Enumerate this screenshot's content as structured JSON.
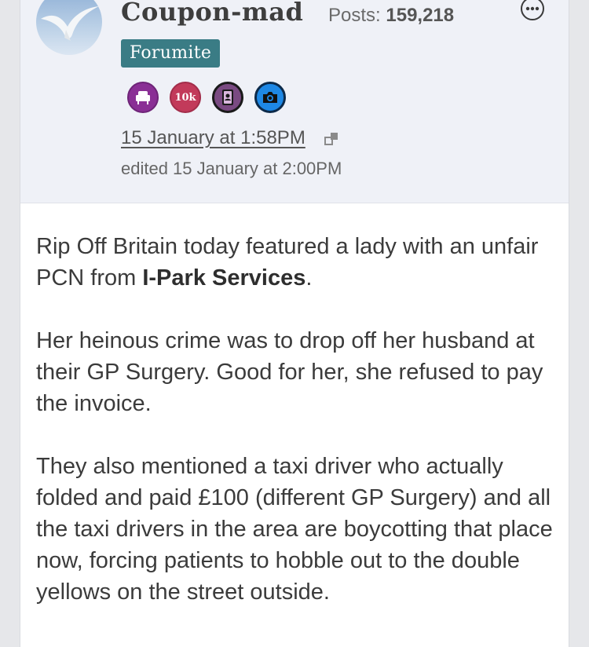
{
  "post": {
    "username": "Coupon-mad",
    "posts_label": "Posts:",
    "posts_count": "159,218",
    "rank": "Forumite",
    "badges": [
      {
        "icon": "armchair-icon",
        "color": "#8a2f95"
      },
      {
        "icon": "10k-badge",
        "label": "10k",
        "color": "#c23a5a"
      },
      {
        "icon": "address-book-icon",
        "color": "#7a4a82"
      },
      {
        "icon": "camera-icon",
        "color": "#1e88e5"
      }
    ],
    "date": "15 January at 1:58PM",
    "edited": "edited 15 January at 2:00PM",
    "body": {
      "p1_pre": "Rip Off Britain today featured a lady with an unfair PCN from ",
      "p1_bold": "I-Park Services",
      "p1_post": ".",
      "p2": "Her heinous crime was to drop off her husband at their GP Surgery. Good for her, she refused to pay the invoice.",
      "p3": "They also mentioned a taxi driver who actually folded and paid £100 (different GP Surgery) and all the taxi drivers in the area are boycotting that place now, forcing patients to hobble out to the double yellows on the street outside."
    }
  }
}
